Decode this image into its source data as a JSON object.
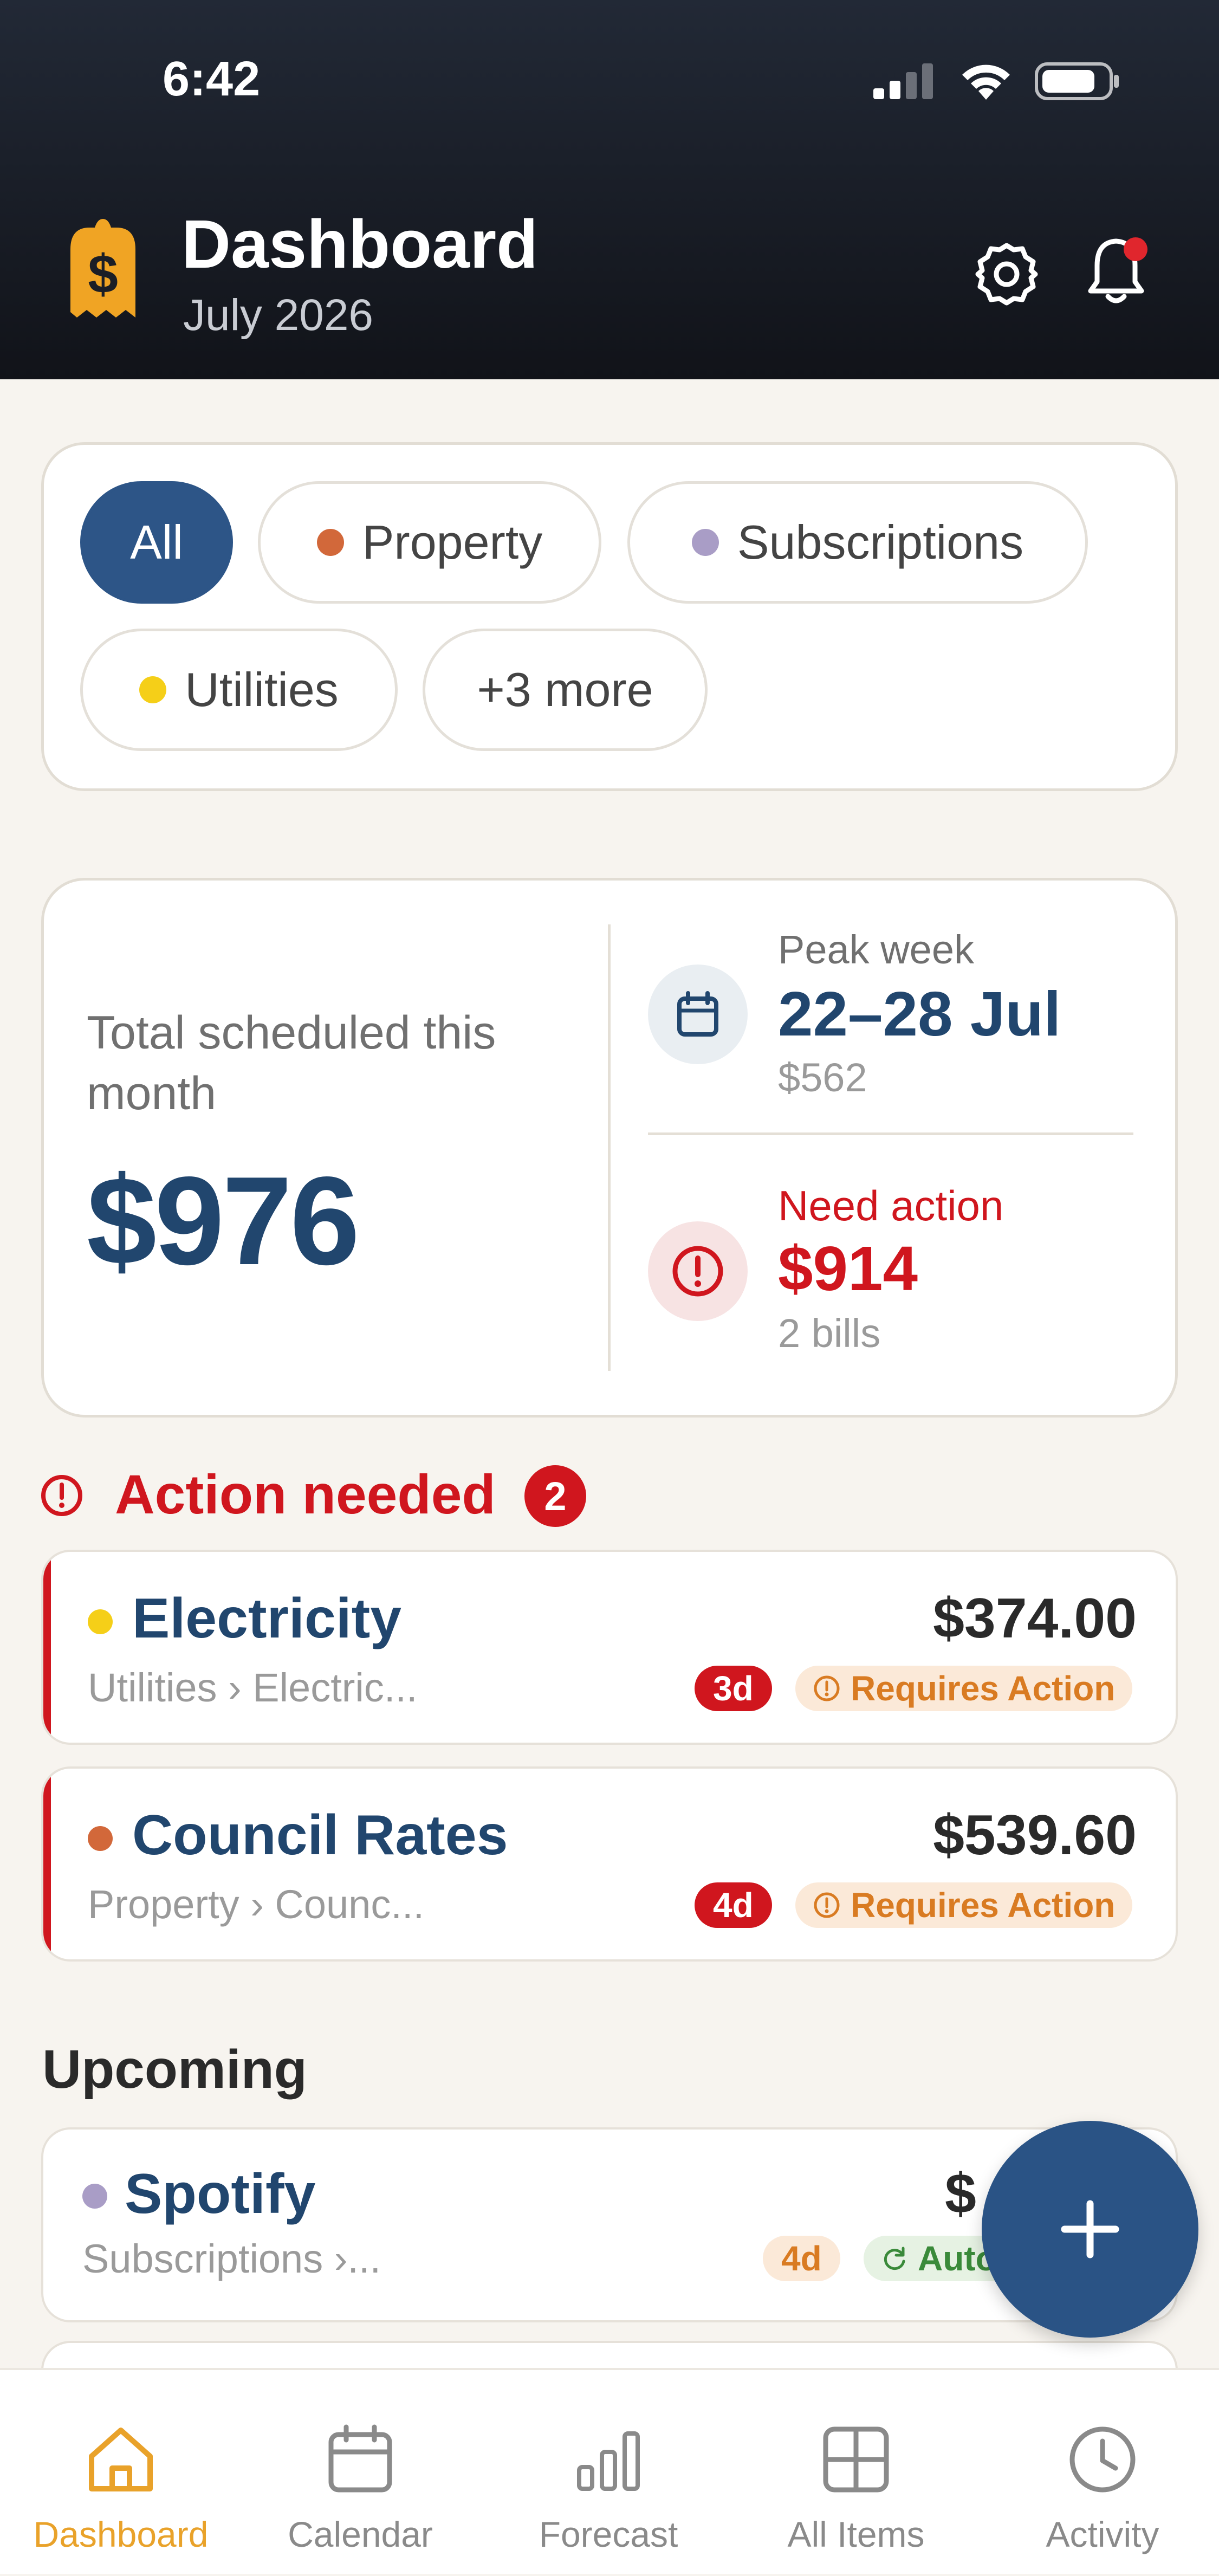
{
  "status_bar": {
    "time": "6:42"
  },
  "header": {
    "title": "Dashboard",
    "subtitle": "July 2026"
  },
  "filters": [
    {
      "label": "All",
      "active": true
    },
    {
      "label": "Property",
      "dot_color": "#d2683a"
    },
    {
      "label": "Subscriptions",
      "dot_color": "#a99dc6"
    },
    {
      "label": "Utilities",
      "dot_color": "#f5cf18"
    },
    {
      "label": "+3 more"
    }
  ],
  "summary": {
    "total_label": "Total scheduled this month",
    "total_amount": "$976",
    "peak": {
      "label": "Peak week",
      "range": "22–28 Jul",
      "amount": "$562"
    },
    "action": {
      "label": "Need action",
      "amount": "$914",
      "count": "2 bills"
    }
  },
  "action_section": {
    "title": "Action needed",
    "count": "2",
    "items": [
      {
        "name": "Electricity",
        "path": "Utilities › Electric...",
        "amount": "$374.00",
        "days": "3d",
        "status": "Requires Action",
        "dot_color": "#f5cf18"
      },
      {
        "name": "Council Rates",
        "path": "Property › Counc...",
        "amount": "$539.60",
        "days": "4d",
        "status": "Requires Action",
        "dot_color": "#d2683a"
      }
    ]
  },
  "upcoming_section": {
    "title": "Upcoming",
    "items": [
      {
        "name": "Spotify",
        "path": "Subscriptions ›...",
        "amount": "$",
        "days": "4d",
        "status": "Auto-",
        "dot_color": "#a99dc6"
      }
    ]
  },
  "bottom_nav": [
    {
      "label": "Dashboard",
      "icon": "home-icon",
      "active": true
    },
    {
      "label": "Calendar",
      "icon": "calendar-icon"
    },
    {
      "label": "Forecast",
      "icon": "bar-chart-icon"
    },
    {
      "label": "All Items",
      "icon": "grid-icon"
    },
    {
      "label": "Activity",
      "icon": "clock-icon"
    }
  ],
  "colors": {
    "primary": "#2d5587",
    "danger": "#d0161e",
    "accent": "#e9a22a"
  }
}
